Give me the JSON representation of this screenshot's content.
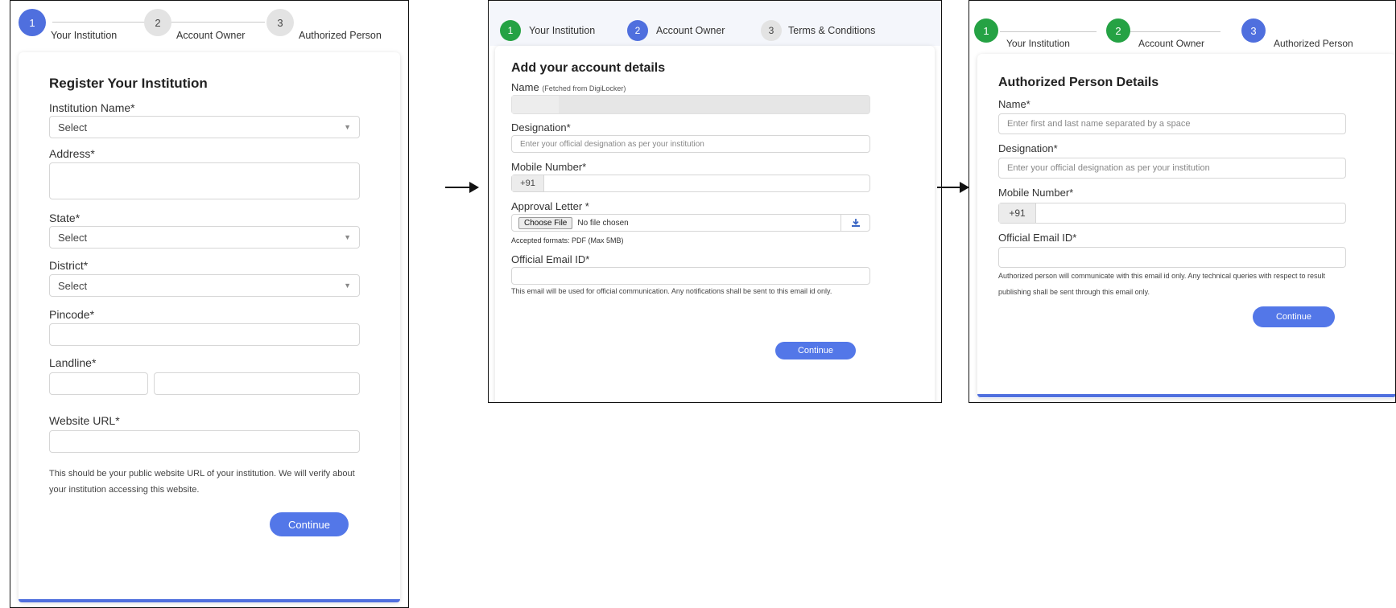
{
  "panel1": {
    "steps": [
      {
        "number": "1",
        "label": "Your Institution"
      },
      {
        "number": "2",
        "label": "Account Owner"
      },
      {
        "number": "3",
        "label": "Authorized Person"
      }
    ],
    "title": "Register Your Institution",
    "institution_label": "Institution Name*",
    "institution_value": "Select",
    "address_label": "Address*",
    "state_label": "State*",
    "state_value": "Select",
    "district_label": "District*",
    "district_value": "Select",
    "pincode_label": "Pincode*",
    "landline_label": "Landline*",
    "website_label": "Website URL*",
    "website_note": "This should be your public website URL of your institution. We will verify about your institution accessing this website.",
    "continue_label": "Continue"
  },
  "panel2": {
    "steps": [
      {
        "number": "1",
        "label": "Your Institution"
      },
      {
        "number": "2",
        "label": "Account Owner"
      },
      {
        "number": "3",
        "label": "Terms & Conditions"
      }
    ],
    "title": "Add your account details",
    "name_label": "Name",
    "name_hint": "(Fetched from DigiLocker)",
    "designation_label": "Designation*",
    "designation_placeholder": "Enter your official designation as per your institution",
    "mobile_label": "Mobile Number*",
    "mobile_prefix": "+91",
    "approval_label": "Approval Letter *",
    "choose_file_label": "Choose File",
    "no_file_label": "No file chosen",
    "accepted_formats": "Accepted formats: PDF (Max 5MB)",
    "email_label": "Official Email ID*",
    "email_note": "This email will be used for official communication. Any notifications shall be sent to this email id only.",
    "continue_label": "Continue"
  },
  "panel3": {
    "steps": [
      {
        "number": "1",
        "label": "Your Institution"
      },
      {
        "number": "2",
        "label": "Account Owner"
      },
      {
        "number": "3",
        "label": "Authorized Person"
      }
    ],
    "title": "Authorized Person Details",
    "name_label": "Name*",
    "name_placeholder": "Enter first and last name separated by a space",
    "designation_label": "Designation*",
    "designation_placeholder": "Enter your official designation as per your institution",
    "mobile_label": "Mobile Number*",
    "mobile_prefix": "+91",
    "email_label": "Official Email ID*",
    "email_note": "Authorized person will communicate with this email id only. Any technical queries with respect to result publishing shall be sent through this email only.",
    "continue_label": "Continue"
  },
  "colors": {
    "active_step": "#4f6fde",
    "completed_step": "#25a244",
    "pending_step": "#e3e3e3",
    "button": "#5377e8"
  }
}
